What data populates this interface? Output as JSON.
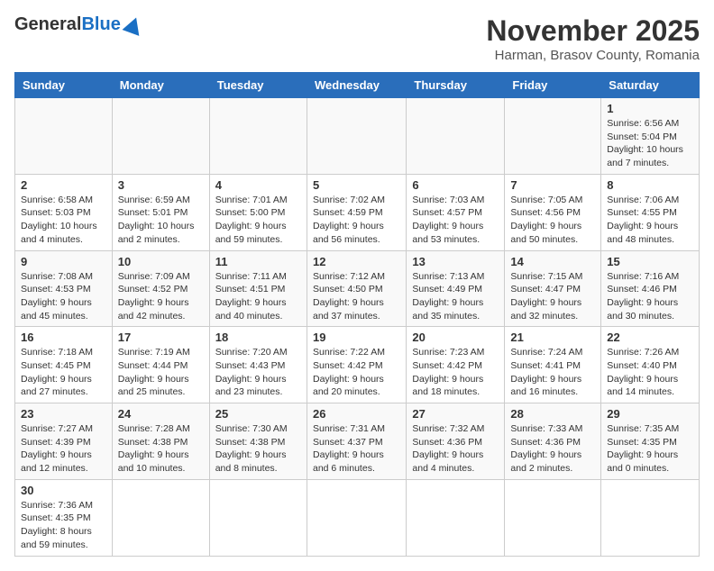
{
  "header": {
    "logo_general": "General",
    "logo_blue": "Blue",
    "month_title": "November 2025",
    "subtitle": "Harman, Brasov County, Romania"
  },
  "days_of_week": [
    "Sunday",
    "Monday",
    "Tuesday",
    "Wednesday",
    "Thursday",
    "Friday",
    "Saturday"
  ],
  "weeks": [
    [
      {
        "day": "",
        "info": ""
      },
      {
        "day": "",
        "info": ""
      },
      {
        "day": "",
        "info": ""
      },
      {
        "day": "",
        "info": ""
      },
      {
        "day": "",
        "info": ""
      },
      {
        "day": "",
        "info": ""
      },
      {
        "day": "1",
        "info": "Sunrise: 6:56 AM\nSunset: 5:04 PM\nDaylight: 10 hours and 7 minutes."
      }
    ],
    [
      {
        "day": "2",
        "info": "Sunrise: 6:58 AM\nSunset: 5:03 PM\nDaylight: 10 hours and 4 minutes."
      },
      {
        "day": "3",
        "info": "Sunrise: 6:59 AM\nSunset: 5:01 PM\nDaylight: 10 hours and 2 minutes."
      },
      {
        "day": "4",
        "info": "Sunrise: 7:01 AM\nSunset: 5:00 PM\nDaylight: 9 hours and 59 minutes."
      },
      {
        "day": "5",
        "info": "Sunrise: 7:02 AM\nSunset: 4:59 PM\nDaylight: 9 hours and 56 minutes."
      },
      {
        "day": "6",
        "info": "Sunrise: 7:03 AM\nSunset: 4:57 PM\nDaylight: 9 hours and 53 minutes."
      },
      {
        "day": "7",
        "info": "Sunrise: 7:05 AM\nSunset: 4:56 PM\nDaylight: 9 hours and 50 minutes."
      },
      {
        "day": "8",
        "info": "Sunrise: 7:06 AM\nSunset: 4:55 PM\nDaylight: 9 hours and 48 minutes."
      }
    ],
    [
      {
        "day": "9",
        "info": "Sunrise: 7:08 AM\nSunset: 4:53 PM\nDaylight: 9 hours and 45 minutes."
      },
      {
        "day": "10",
        "info": "Sunrise: 7:09 AM\nSunset: 4:52 PM\nDaylight: 9 hours and 42 minutes."
      },
      {
        "day": "11",
        "info": "Sunrise: 7:11 AM\nSunset: 4:51 PM\nDaylight: 9 hours and 40 minutes."
      },
      {
        "day": "12",
        "info": "Sunrise: 7:12 AM\nSunset: 4:50 PM\nDaylight: 9 hours and 37 minutes."
      },
      {
        "day": "13",
        "info": "Sunrise: 7:13 AM\nSunset: 4:49 PM\nDaylight: 9 hours and 35 minutes."
      },
      {
        "day": "14",
        "info": "Sunrise: 7:15 AM\nSunset: 4:47 PM\nDaylight: 9 hours and 32 minutes."
      },
      {
        "day": "15",
        "info": "Sunrise: 7:16 AM\nSunset: 4:46 PM\nDaylight: 9 hours and 30 minutes."
      }
    ],
    [
      {
        "day": "16",
        "info": "Sunrise: 7:18 AM\nSunset: 4:45 PM\nDaylight: 9 hours and 27 minutes."
      },
      {
        "day": "17",
        "info": "Sunrise: 7:19 AM\nSunset: 4:44 PM\nDaylight: 9 hours and 25 minutes."
      },
      {
        "day": "18",
        "info": "Sunrise: 7:20 AM\nSunset: 4:43 PM\nDaylight: 9 hours and 23 minutes."
      },
      {
        "day": "19",
        "info": "Sunrise: 7:22 AM\nSunset: 4:42 PM\nDaylight: 9 hours and 20 minutes."
      },
      {
        "day": "20",
        "info": "Sunrise: 7:23 AM\nSunset: 4:42 PM\nDaylight: 9 hours and 18 minutes."
      },
      {
        "day": "21",
        "info": "Sunrise: 7:24 AM\nSunset: 4:41 PM\nDaylight: 9 hours and 16 minutes."
      },
      {
        "day": "22",
        "info": "Sunrise: 7:26 AM\nSunset: 4:40 PM\nDaylight: 9 hours and 14 minutes."
      }
    ],
    [
      {
        "day": "23",
        "info": "Sunrise: 7:27 AM\nSunset: 4:39 PM\nDaylight: 9 hours and 12 minutes."
      },
      {
        "day": "24",
        "info": "Sunrise: 7:28 AM\nSunset: 4:38 PM\nDaylight: 9 hours and 10 minutes."
      },
      {
        "day": "25",
        "info": "Sunrise: 7:30 AM\nSunset: 4:38 PM\nDaylight: 9 hours and 8 minutes."
      },
      {
        "day": "26",
        "info": "Sunrise: 7:31 AM\nSunset: 4:37 PM\nDaylight: 9 hours and 6 minutes."
      },
      {
        "day": "27",
        "info": "Sunrise: 7:32 AM\nSunset: 4:36 PM\nDaylight: 9 hours and 4 minutes."
      },
      {
        "day": "28",
        "info": "Sunrise: 7:33 AM\nSunset: 4:36 PM\nDaylight: 9 hours and 2 minutes."
      },
      {
        "day": "29",
        "info": "Sunrise: 7:35 AM\nSunset: 4:35 PM\nDaylight: 9 hours and 0 minutes."
      }
    ],
    [
      {
        "day": "30",
        "info": "Sunrise: 7:36 AM\nSunset: 4:35 PM\nDaylight: 8 hours and 59 minutes."
      },
      {
        "day": "",
        "info": ""
      },
      {
        "day": "",
        "info": ""
      },
      {
        "day": "",
        "info": ""
      },
      {
        "day": "",
        "info": ""
      },
      {
        "day": "",
        "info": ""
      },
      {
        "day": "",
        "info": ""
      }
    ]
  ]
}
